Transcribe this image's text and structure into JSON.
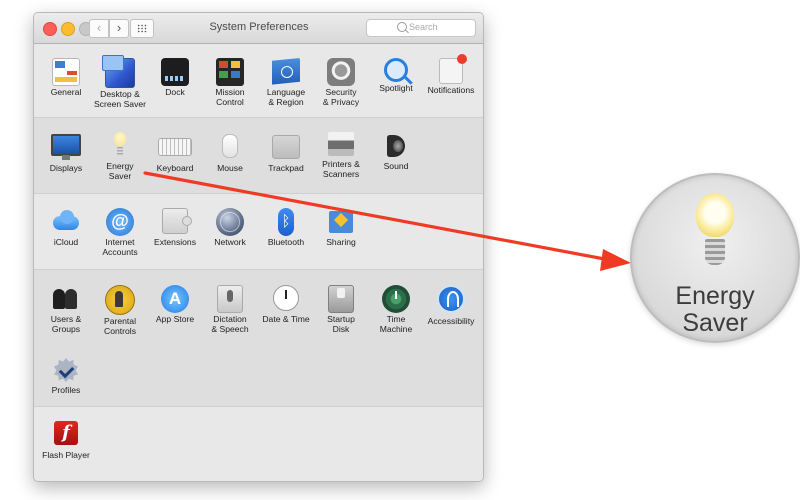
{
  "window": {
    "title": "System Preferences",
    "search_placeholder": "Search"
  },
  "sections": [
    {
      "items": [
        {
          "label": "General",
          "icon": "general-icon"
        },
        {
          "label": "Desktop &\nScreen Saver",
          "icon": "desktop-screensaver-icon"
        },
        {
          "label": "Dock",
          "icon": "dock-icon"
        },
        {
          "label": "Mission\nControl",
          "icon": "mission-control-icon"
        },
        {
          "label": "Language\n& Region",
          "icon": "language-region-flag-icon"
        },
        {
          "label": "Security\n& Privacy",
          "icon": "security-privacy-icon"
        },
        {
          "label": "Spotlight",
          "icon": "spotlight-icon"
        },
        {
          "label": "Notifications",
          "icon": "notifications-icon"
        }
      ]
    },
    {
      "items": [
        {
          "label": "Displays",
          "icon": "displays-icon"
        },
        {
          "label": "Energy\nSaver",
          "icon": "energy-saver-bulb-icon"
        },
        {
          "label": "Keyboard",
          "icon": "keyboard-icon"
        },
        {
          "label": "Mouse",
          "icon": "mouse-icon"
        },
        {
          "label": "Trackpad",
          "icon": "trackpad-icon"
        },
        {
          "label": "Printers &\nScanners",
          "icon": "printer-icon"
        },
        {
          "label": "Sound",
          "icon": "speaker-icon"
        }
      ]
    },
    {
      "items": [
        {
          "label": "iCloud",
          "icon": "icloud-icon"
        },
        {
          "label": "Internet\nAccounts",
          "icon": "internet-accounts-icon"
        },
        {
          "label": "Extensions",
          "icon": "extensions-icon"
        },
        {
          "label": "Network",
          "icon": "network-globe-icon"
        },
        {
          "label": "Bluetooth",
          "icon": "bluetooth-icon"
        },
        {
          "label": "Sharing",
          "icon": "sharing-icon"
        }
      ]
    },
    {
      "items": [
        {
          "label": "Users &\nGroups",
          "icon": "users-groups-icon"
        },
        {
          "label": "Parental\nControls",
          "icon": "parental-controls-icon"
        },
        {
          "label": "App Store",
          "icon": "app-store-icon"
        },
        {
          "label": "Dictation\n& Speech",
          "icon": "dictation-microphone-icon"
        },
        {
          "label": "Date & Time",
          "icon": "date-time-clock-icon"
        },
        {
          "label": "Startup\nDisk",
          "icon": "startup-disk-icon"
        },
        {
          "label": "Time\nMachine",
          "icon": "time-machine-icon"
        },
        {
          "label": "Accessibility",
          "icon": "accessibility-icon"
        },
        {
          "label": "Profiles",
          "icon": "profiles-badge-icon"
        }
      ]
    },
    {
      "items": [
        {
          "label": "Flash Player",
          "icon": "flash-player-icon"
        }
      ]
    }
  ],
  "callout": {
    "label": "Energy\nSaver",
    "icon": "energy-saver-bulb-icon",
    "arrow_color": "#ef3b24"
  }
}
